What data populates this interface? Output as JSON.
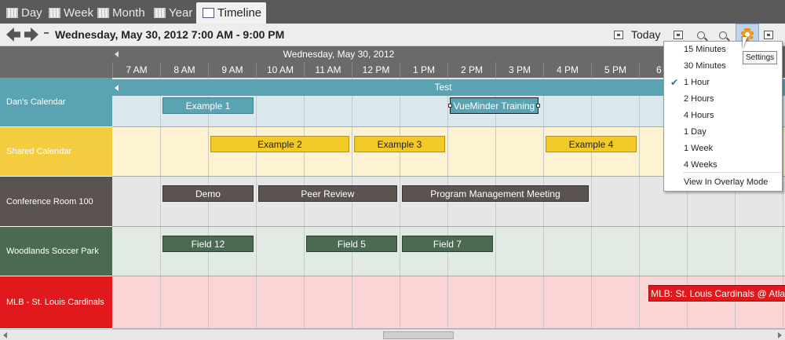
{
  "tabs": [
    {
      "label": "Day",
      "active": false
    },
    {
      "label": "Week",
      "active": false
    },
    {
      "label": "Month",
      "active": false
    },
    {
      "label": "Year",
      "active": false
    },
    {
      "label": "Timeline",
      "active": true
    }
  ],
  "toolbar": {
    "date_range": "Wednesday, May 30, 2012  7:00 AM - 9:00 PM",
    "today_label": "Today"
  },
  "timeline": {
    "date": "Wednesday, May 30, 2012",
    "hours": [
      "7 AM",
      "8 AM",
      "9 AM",
      "10 AM",
      "11 AM",
      "12 PM",
      "1 PM",
      "2 PM",
      "3 PM",
      "4 PM",
      "5 PM",
      "6 P"
    ]
  },
  "calendars": [
    {
      "name": "Dan's Calendar",
      "label_color": "#5aa3b3",
      "lane_color": "#dbe9ee",
      "all_day": "Test",
      "events": [
        {
          "title": "Example 1",
          "color": "#5aa3b3",
          "text": "#fff",
          "border": "#3f7f8e",
          "start": 1,
          "span": 1.9
        },
        {
          "title": "VueMinder Training",
          "color": "#5aa3b3",
          "text": "#fff",
          "border": "#222",
          "start": 7,
          "span": 1.85,
          "selected": true
        }
      ]
    },
    {
      "name": "Shared Calendar",
      "label_color": "#f3cc3f",
      "lane_color": "#fdf3d3",
      "events": [
        {
          "title": "Example 2",
          "color": "#f3c928",
          "text": "#222",
          "border": "#b8940e",
          "start": 2,
          "span": 2.9
        },
        {
          "title": "Example 3",
          "color": "#f3c928",
          "text": "#222",
          "border": "#b8940e",
          "start": 5,
          "span": 1.9
        },
        {
          "title": "Example 4",
          "color": "#f3c928",
          "text": "#222",
          "border": "#b8940e",
          "start": 9,
          "span": 1.9
        }
      ]
    },
    {
      "name": "Conference Room 100",
      "label_color": "#5a5350",
      "lane_color": "#e6e6e6",
      "events": [
        {
          "title": "Demo",
          "color": "#5a5350",
          "text": "#fff",
          "border": "#3a3330",
          "start": 1,
          "span": 1.9
        },
        {
          "title": "Peer Review",
          "color": "#5a5350",
          "text": "#fff",
          "border": "#3a3330",
          "start": 3,
          "span": 2.9
        },
        {
          "title": "Program Management Meeting",
          "color": "#5a5350",
          "text": "#fff",
          "border": "#3a3330",
          "start": 6,
          "span": 3.9
        }
      ]
    },
    {
      "name": "Woodlands Soccer Park",
      "label_color": "#4a6a52",
      "lane_color": "#e1ebe3",
      "events": [
        {
          "title": "Field 12",
          "color": "#4a6a52",
          "text": "#fff",
          "border": "#2d4632",
          "start": 1,
          "span": 1.9
        },
        {
          "title": "Field 5",
          "color": "#4a6a52",
          "text": "#fff",
          "border": "#2d4632",
          "start": 4,
          "span": 1.9
        },
        {
          "title": "Field 7",
          "color": "#4a6a52",
          "text": "#fff",
          "border": "#2d4632",
          "start": 6,
          "span": 1.9
        }
      ]
    },
    {
      "name": "MLB - St. Louis Cardinals",
      "label_color": "#e1181c",
      "lane_color": "#fad5d5",
      "events": [
        {
          "title": "MLB: St. Louis Cardinals @ Atla",
          "color": "#e1181c",
          "text": "#fff",
          "border": "#a00",
          "start": 11.15,
          "span": 2.9
        }
      ]
    }
  ],
  "settings_tooltip": "Settings",
  "menu": {
    "items": [
      "15 Minutes",
      "30 Minutes",
      "1 Hour",
      "2 Hours",
      "4 Hours",
      "1 Day",
      "1 Week",
      "4 Weeks"
    ],
    "checked": "1 Hour",
    "extra": "View In Overlay Mode"
  },
  "icons": [
    "day-icon",
    "week-icon",
    "month-icon",
    "year-icon",
    "timeline-icon",
    "back-arrow-icon",
    "forward-arrow-icon",
    "today-icon",
    "fit-icon",
    "zoom-out-icon",
    "zoom-in-icon",
    "gear-icon",
    "options-icon"
  ]
}
